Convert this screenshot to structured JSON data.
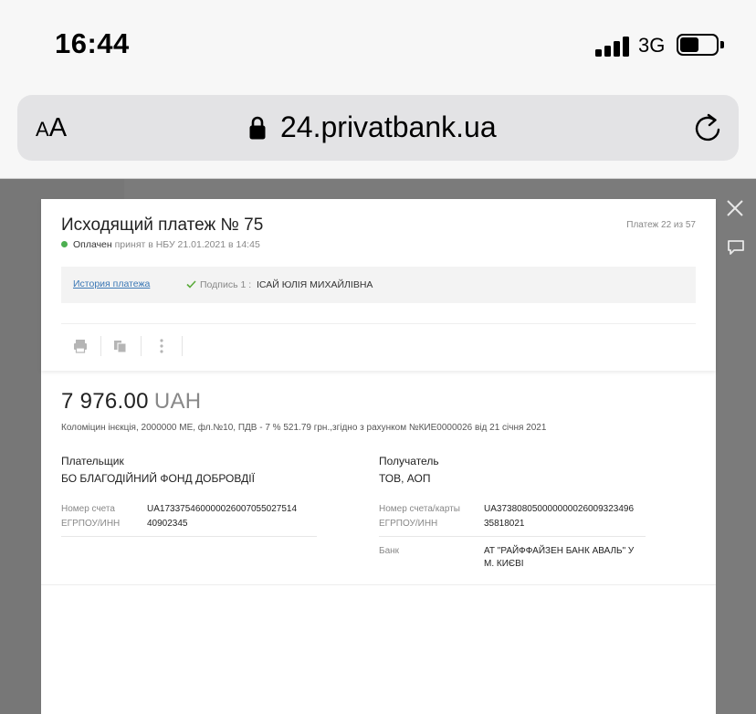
{
  "status_bar": {
    "time": "16:44",
    "network": "3G"
  },
  "browser": {
    "text_size_small": "A",
    "text_size_big": "A",
    "url": "24.privatbank.ua"
  },
  "payment": {
    "title": "Исходящий платеж № 75",
    "counter": "Платеж 22 из 57",
    "status": "Оплачен",
    "status_detail": "принят в НБУ 21.01.2021 в 14:45",
    "status_color": "#4caf50",
    "history_link": "История платежа",
    "signature_label": "Подпись 1 :",
    "signature_name": "ІСАЙ ЮЛІЯ МИХАЙЛІВНА",
    "toolbar": [
      "printer-icon",
      "copy-icon",
      "more-icon"
    ],
    "amount": "7 976.00",
    "currency": "UAH",
    "purpose": "Коломіцин інєкція, 2000000 МЕ, фл.№10, ПДВ - 7 % 521.79 грн.,згідно з рахунком №КИЕ0000026 від 21 січня 2021",
    "payer": {
      "title": "Плательщик",
      "name": "БО БЛАГОДІЙНИЙ ФОНД ДОБРОВДІЇ",
      "account_label": "Номер счета",
      "account": "UA173375460000026007055027514",
      "edrpou_label": "ЕГРПОУ/ИНН",
      "edrpou": "40902345"
    },
    "recipient": {
      "title": "Получатель",
      "name": "ТОВ, АОП",
      "account_label": "Номер счета/карты",
      "account": "UA373808050000000026009323496",
      "edrpou_label": "ЕГРПОУ/ИНН",
      "edrpou": "35818021",
      "bank_label": "Банк",
      "bank_line1": "АТ \"РАЙФФАЙЗЕН БАНК АВАЛЬ\" У",
      "bank_line2": "М. КИЄВІ"
    }
  },
  "colors": {
    "link": "#3a77b5",
    "backdrop": "#7b7b7b"
  }
}
